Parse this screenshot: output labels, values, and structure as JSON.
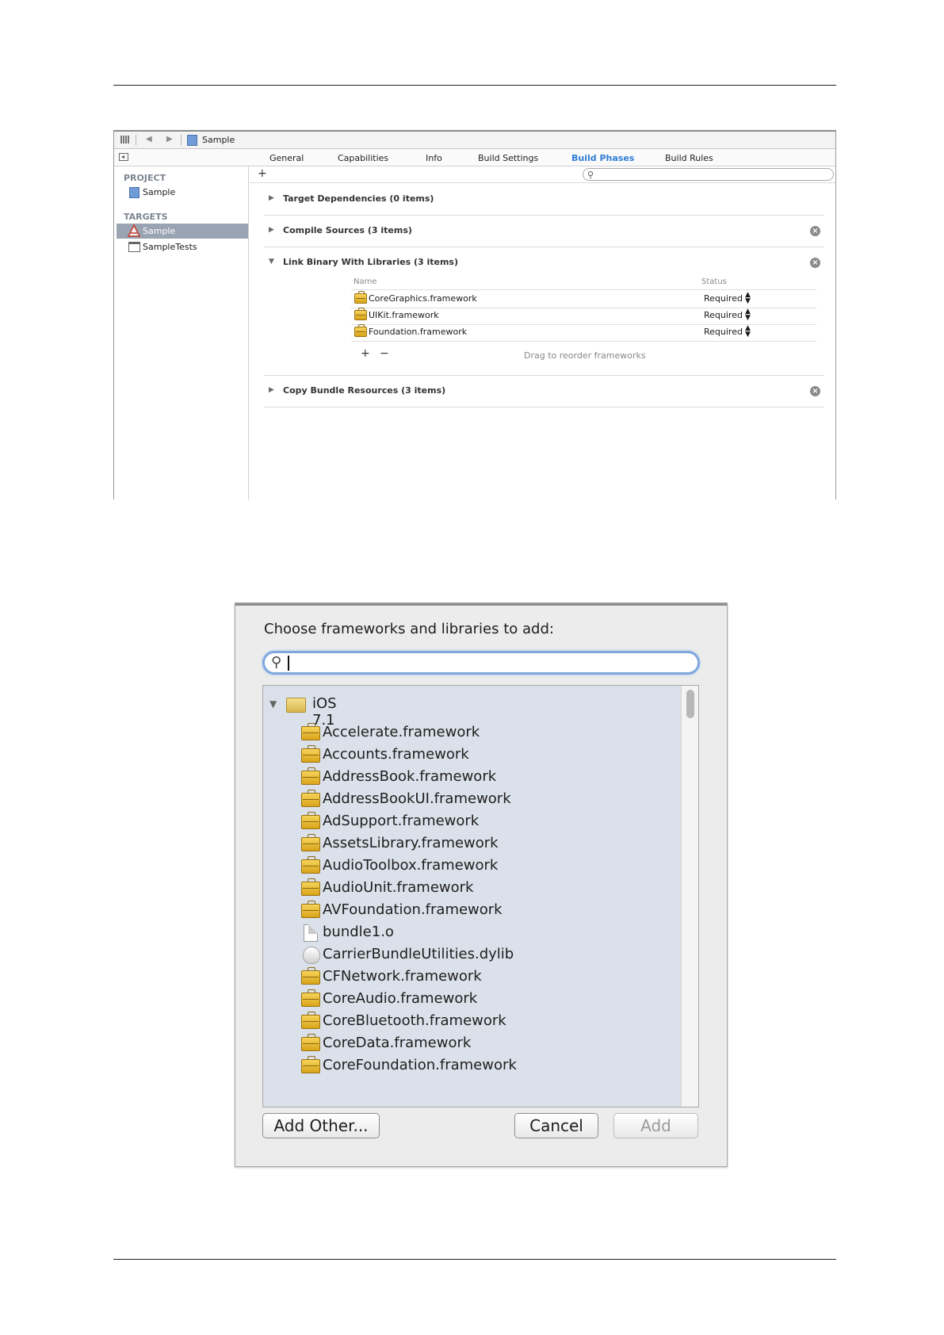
{
  "xcode": {
    "jumpbar": {
      "title": "Sample"
    },
    "tabs": [
      "General",
      "Capabilities",
      "Info",
      "Build Settings",
      "Build Phases",
      "Build Rules"
    ],
    "active_tab": "Build Phases",
    "sidebar": {
      "project_header": "PROJECT",
      "project_item": "Sample",
      "targets_header": "TARGETS",
      "target_items": [
        "Sample",
        "SampleTests"
      ]
    },
    "add_symbol": "+",
    "phases": [
      {
        "title": "Target Dependencies (0 items)",
        "expanded": false,
        "removable": false
      },
      {
        "title": "Compile Sources (3 items)",
        "expanded": false,
        "removable": true
      },
      {
        "title": "Link Binary With Libraries (3 items)",
        "expanded": true,
        "removable": true
      },
      {
        "title": "Copy Bundle Resources (3 items)",
        "expanded": false,
        "removable": true
      }
    ],
    "library_table": {
      "col_name": "Name",
      "col_status": "Status",
      "rows": [
        {
          "name": "CoreGraphics.framework",
          "status": "Required"
        },
        {
          "name": "UIKit.framework",
          "status": "Required"
        },
        {
          "name": "Foundation.framework",
          "status": "Required"
        }
      ],
      "add": "+",
      "remove": "−",
      "hint": "Drag to reorder frameworks"
    }
  },
  "dialog": {
    "title": "Choose frameworks and libraries to add:",
    "search_value": "",
    "group": "iOS 7.1",
    "items": [
      {
        "name": "Accelerate.framework",
        "icon": "framework-icon"
      },
      {
        "name": "Accounts.framework",
        "icon": "framework-icon"
      },
      {
        "name": "AddressBook.framework",
        "icon": "framework-icon"
      },
      {
        "name": "AddressBookUI.framework",
        "icon": "framework-icon"
      },
      {
        "name": "AdSupport.framework",
        "icon": "framework-icon"
      },
      {
        "name": "AssetsLibrary.framework",
        "icon": "framework-icon"
      },
      {
        "name": "AudioToolbox.framework",
        "icon": "framework-icon"
      },
      {
        "name": "AudioUnit.framework",
        "icon": "framework-icon"
      },
      {
        "name": "AVFoundation.framework",
        "icon": "framework-icon"
      },
      {
        "name": "bundle1.o",
        "icon": "file-icon"
      },
      {
        "name": "CarrierBundleUtilities.dylib",
        "icon": "library-icon"
      },
      {
        "name": "CFNetwork.framework",
        "icon": "framework-icon"
      },
      {
        "name": "CoreAudio.framework",
        "icon": "framework-icon"
      },
      {
        "name": "CoreBluetooth.framework",
        "icon": "framework-icon"
      },
      {
        "name": "CoreData.framework",
        "icon": "framework-icon"
      },
      {
        "name": "CoreFoundation.framework",
        "icon": "framework-icon"
      }
    ],
    "buttons": {
      "add_other": "Add Other...",
      "cancel": "Cancel",
      "add": "Add"
    }
  },
  "colors": {
    "accent_tab": "#2e7bd6",
    "list_background": "#dbe1ea",
    "selected_target": "#9aa3b2",
    "search_focus": "#7fa8df"
  }
}
